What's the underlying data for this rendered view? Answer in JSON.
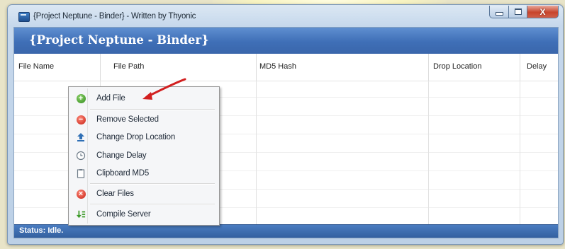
{
  "window": {
    "title": "{Project Neptune - Binder} - Written by Thyonic",
    "close_glyph": "X"
  },
  "header": {
    "title": "{Project Neptune - Binder}"
  },
  "table": {
    "columns": [
      "File Name",
      "File Path",
      "MD5 Hash",
      "Drop Location",
      "Delay"
    ],
    "rows": []
  },
  "context_menu": {
    "items": [
      {
        "label": "Add File",
        "icon": "add-icon",
        "color": "#3c9a28"
      },
      {
        "label": "Remove Selected",
        "icon": "remove-icon",
        "color": "#c9241a"
      },
      {
        "label": "Change Drop Location",
        "icon": "upload-icon",
        "color": "#2f6fb5"
      },
      {
        "label": "Change Delay",
        "icon": "clock-icon",
        "color": "#6e7b88"
      },
      {
        "label": "Clipboard MD5",
        "icon": "clipboard-icon",
        "color": "#6e7b88"
      },
      {
        "label": "Clear Files",
        "icon": "clear-icon",
        "color": "#c9241a"
      },
      {
        "label": "Compile Server",
        "icon": "compile-icon",
        "color": "#3c9a28"
      }
    ]
  },
  "status_bar": {
    "text": "Status: Idle."
  },
  "colors": {
    "header_blue": "#3f6fb7",
    "annotation_arrow": "#d21f1f"
  }
}
